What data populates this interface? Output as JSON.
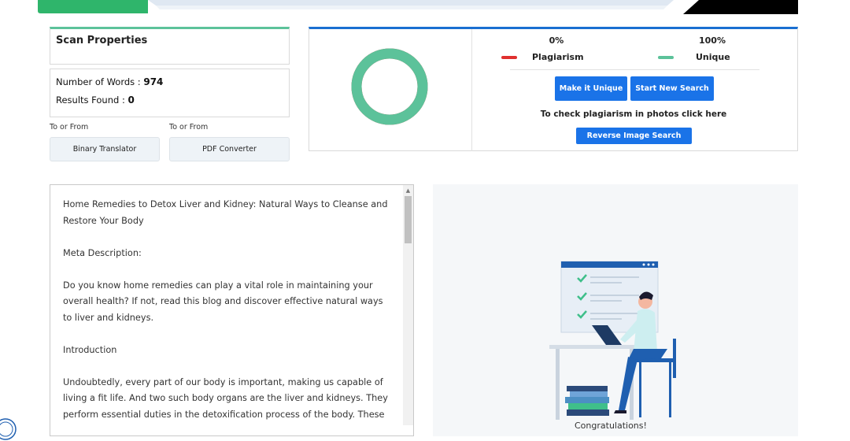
{
  "scan_properties": {
    "title": "Scan Properties",
    "words_label": "Number of Words :",
    "words_value": "974",
    "results_label": "Results Found :",
    "results_value": "0"
  },
  "tools": {
    "from_label_1": "To or From",
    "from_label_2": "To or From",
    "binary_translator": "Binary Translator",
    "pdf_converter": "PDF Converter"
  },
  "results": {
    "plagiarism_percent": "0%",
    "unique_percent": "100%",
    "plagiarism_label": "Plagiarism",
    "unique_label": "Unique",
    "make_unique_button": "Make it Unique",
    "new_search_button": "Start New Search",
    "photo_hint": "To check plagiarism in photos click here",
    "reverse_image_button": "Reverse Image Search",
    "plagiarism_fraction": 0,
    "unique_fraction": 1
  },
  "colors": {
    "plagiarism": "#e0302f",
    "unique": "#5cc29a",
    "primary": "#1a73e8"
  },
  "document": {
    "paragraphs": [
      "Home Remedies to Detox Liver and Kidney: Natural Ways to Cleanse and Restore Your Body",
      "Meta Description:",
      "Do you know home remedies can play a vital role in maintaining your overall health? If not, read this blog and discover effective natural ways to liver and kidneys.",
      "Introduction",
      "Undoubtedly, every part of our body is important, making us capable of living a fit life. And two such body organs are the liver and kidneys. They perform essential duties in the detoxification process of the body. These"
    ]
  },
  "illustration": {
    "caption": "Congratulations!"
  }
}
